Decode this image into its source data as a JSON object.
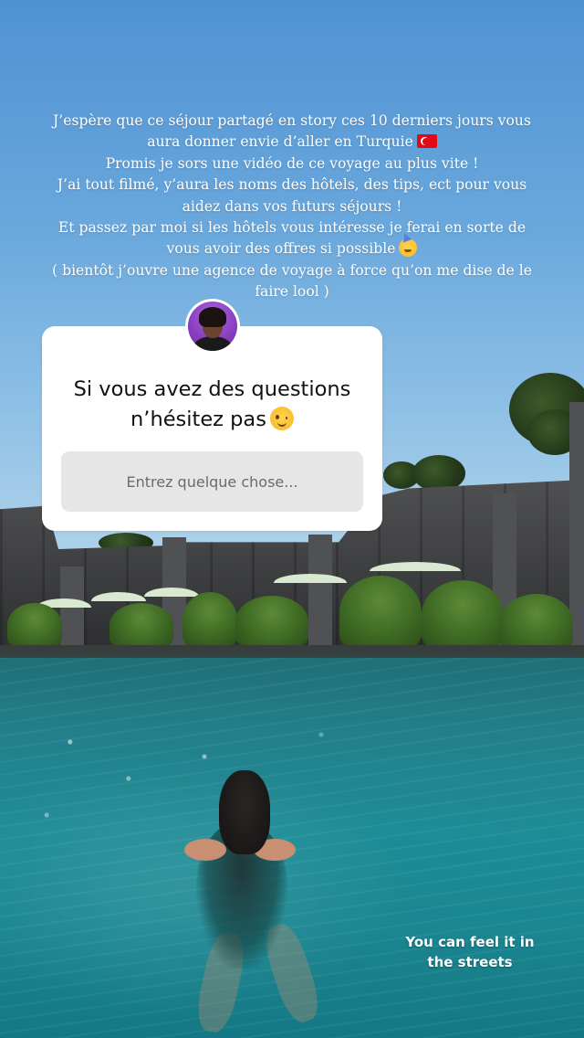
{
  "caption": {
    "lines": [
      "J’espère que ce séjour partagé en story ces 10 derniers jours vous",
      "aura donner envie d’aller en Turquie",
      "Promis je sors une vidéo de ce voyage au plus vite !",
      "J’ai tout filmé, y’aura les noms des hôtels, des tips, ect pour vous",
      "aidez dans vos futurs séjours !",
      "Et passez par moi si les hôtels vous intéresse je ferai en sorte de",
      "vous avoir des offres si possible",
      "( bientôt j’ouvre une agence de voyage à force qu’on me dise de le",
      "faire lool )"
    ],
    "flag_icon": "turkey-flag-emoji",
    "party_icon": "partying-face-emoji"
  },
  "question_sticker": {
    "avatar": "profile-avatar",
    "question_lines": [
      "Si vous avez des questions",
      "n’hésitez pas"
    ],
    "question_icon": "winking-face-emoji",
    "input_placeholder": "Entrez quelque chose..."
  },
  "overlay": {
    "lines": [
      "You can feel it in",
      "the streets"
    ]
  },
  "colors": {
    "text": "#ffffff",
    "sticker_bg": "#ffffff",
    "input_bg": "#e6e6e6",
    "water": "#1d8c96",
    "sky": "#6aa8dc"
  }
}
